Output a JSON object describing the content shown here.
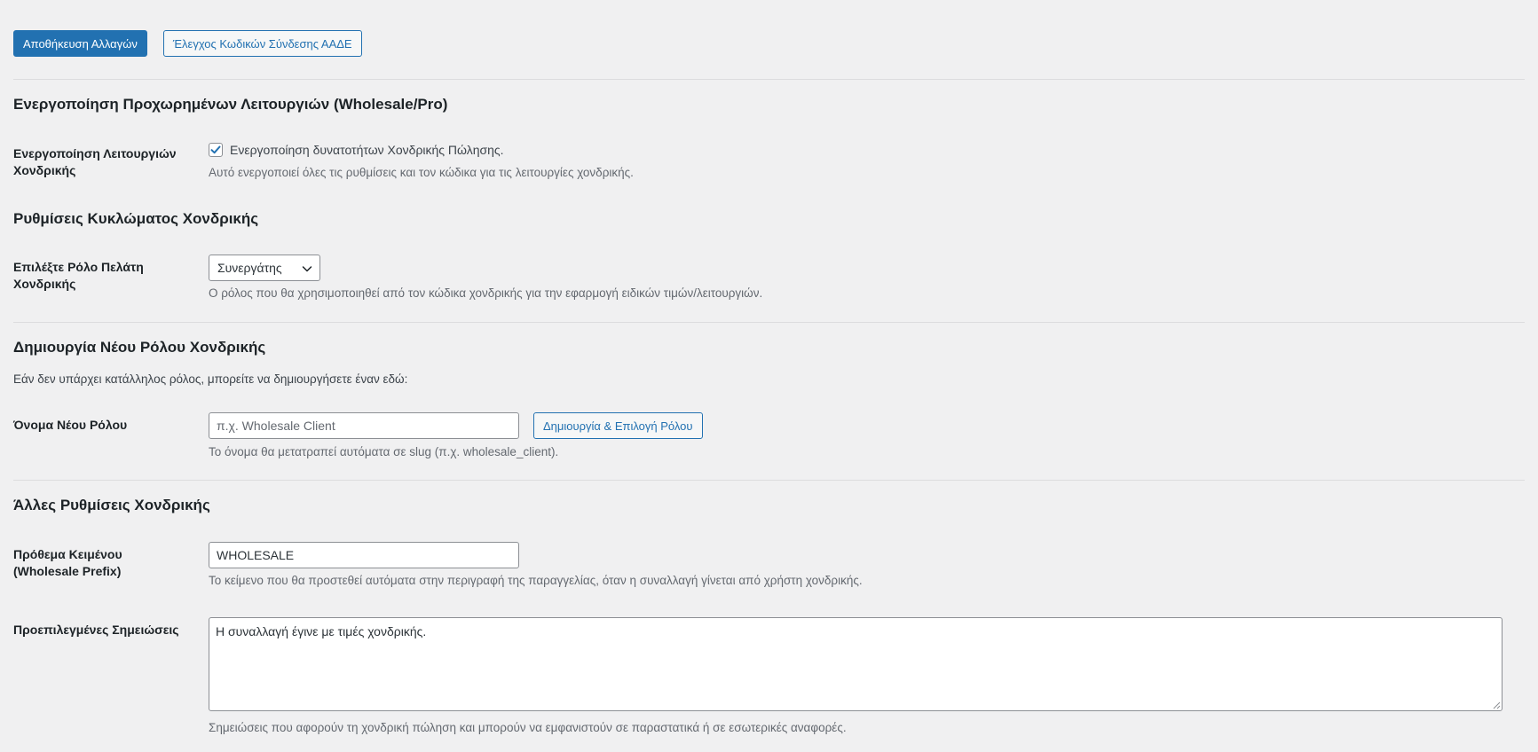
{
  "toolbar": {
    "save_label": "Αποθήκευση Αλλαγών",
    "check_label": "Έλεγχος Κωδικών Σύνδεσης ΑΑΔΕ"
  },
  "sections": {
    "advanced": {
      "title": "Ενεργοποίηση Προχωρημένων Λειτουργιών (Wholesale/Pro)",
      "label": "Ενεργοποίηση Λειτουργιών Χονδρικής",
      "checkbox_label": "Ενεργοποίηση δυνατοτήτων Χονδρικής Πώλησης.",
      "checked": true,
      "description": "Αυτό ενεργοποιεί όλες τις ρυθμίσεις και τον κώδικα για τις λειτουργίες χονδρικής."
    },
    "circuit": {
      "title": "Ρυθμίσεις Κυκλώματος Χονδρικής",
      "label": "Επιλέξτε Ρόλο Πελάτη Χονδρικής",
      "selected_role": "Συνεργάτης",
      "description": "Ο ρόλος που θα χρησιμοποιηθεί από τον κώδικα χονδρικής για την εφαρμογή ειδικών τιμών/λειτουργιών."
    },
    "new_role": {
      "title": "Δημιουργία Νέου Ρόλου Χονδρικής",
      "intro": "Εάν δεν υπάρχει κατάλληλος ρόλος, μπορείτε να δημιουργήσετε έναν εδώ:",
      "label": "Όνομα Νέου Ρόλου",
      "input_value": "",
      "input_placeholder": "π.χ. Wholesale Client",
      "create_button": "Δημιουργία & Επιλογή Ρόλου",
      "description": "Το όνομα θα μετατραπεί αυτόματα σε slug (π.χ. wholesale_client)."
    },
    "other": {
      "title": "Άλλες Ρυθμίσεις Χονδρικής",
      "prefix_label": "Πρόθεμα Κειμένου (Wholesale Prefix)",
      "prefix_value": "WHOLESALE",
      "prefix_description": "Το κείμενο που θα προστεθεί αυτόματα στην περιγραφή της παραγγελίας, όταν η συναλλαγή γίνεται από χρήστη χονδρικής.",
      "notes_label": "Προεπιλεγμένες Σημειώσεις",
      "notes_value": "Η συναλλαγή έγινε με τιμές χονδρικής.",
      "notes_description": "Σημειώσεις που αφορούν τη χονδρική πώληση και μπορούν να εμφανιστούν σε παραστατικά ή σε εσωτερικές αναφορές."
    }
  },
  "colors": {
    "primary": "#2271b1",
    "background": "#f0f0f1",
    "description_text": "#646970"
  },
  "icons": {
    "checkbox": "checkmark-icon",
    "select": "chevron-down-icon",
    "textarea": "resize-grip-icon"
  }
}
